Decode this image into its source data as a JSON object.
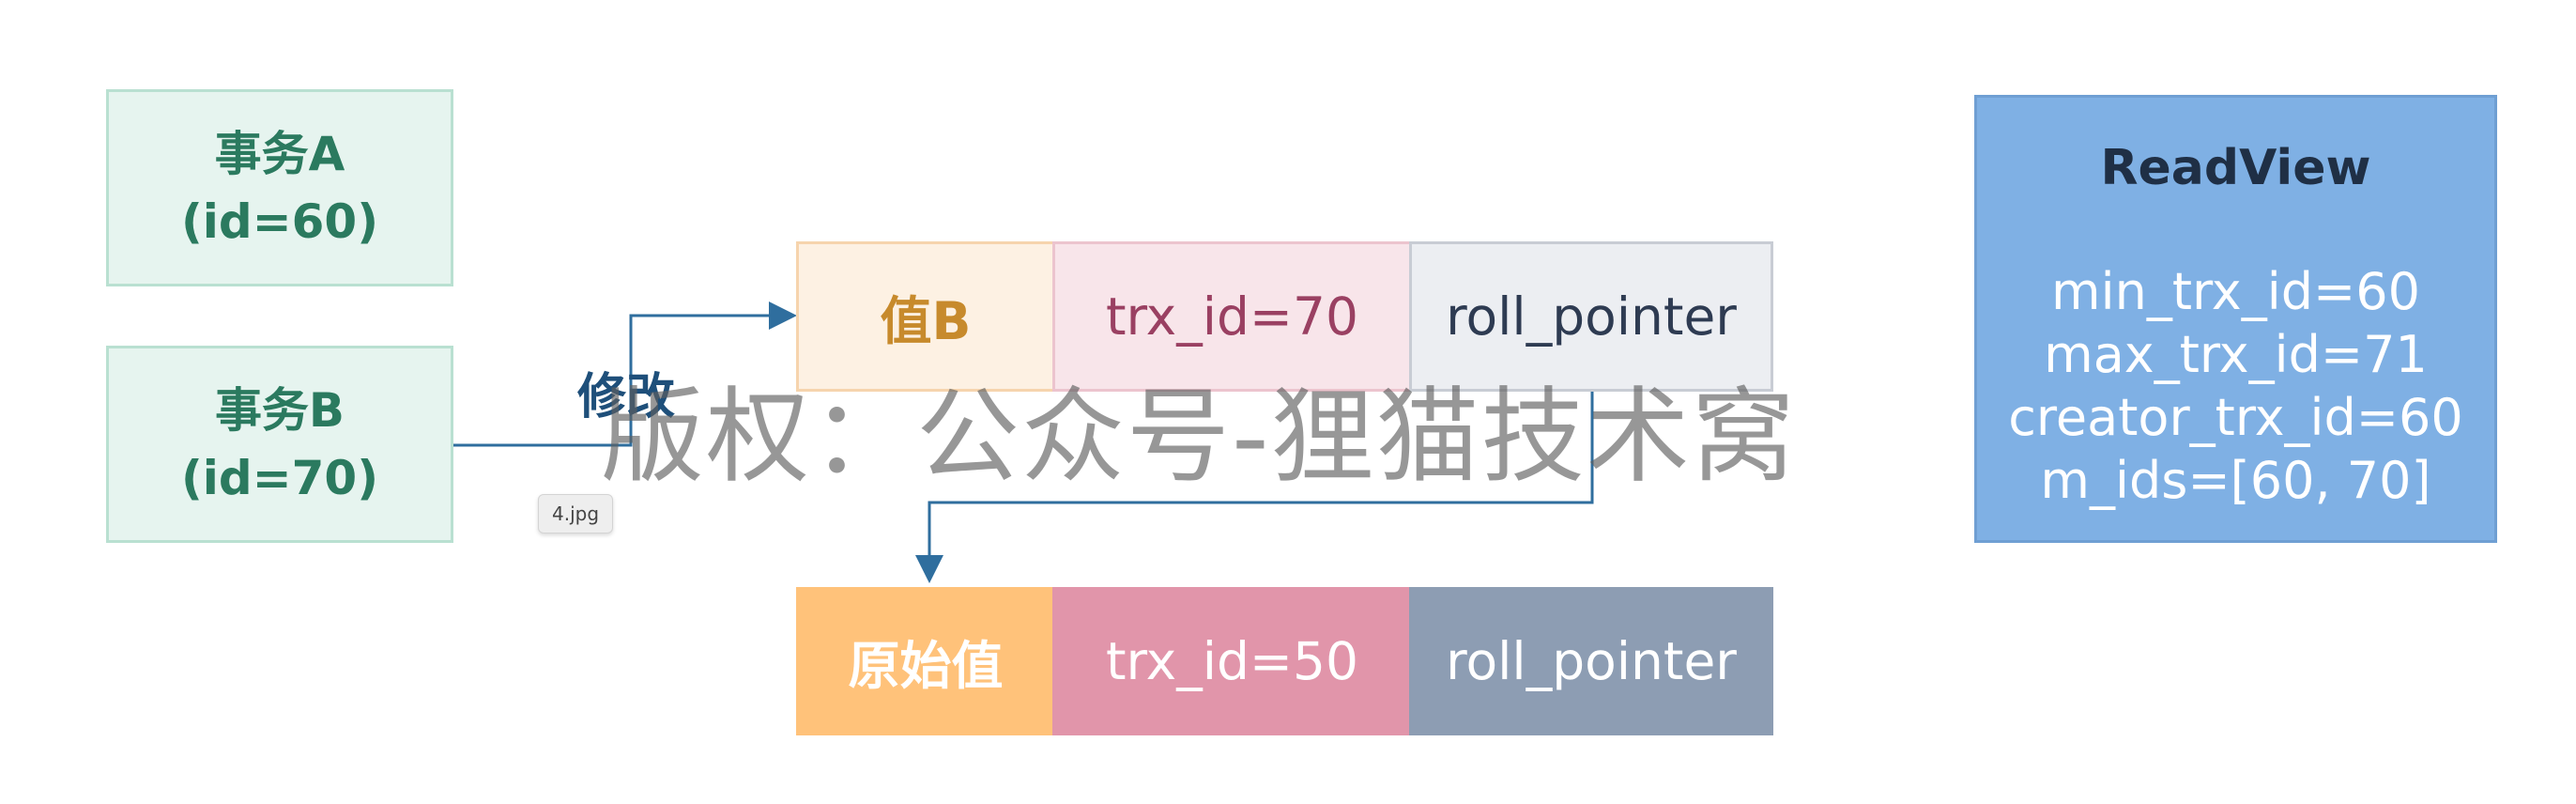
{
  "transactions": {
    "a": {
      "name": "事务A",
      "id": "(id=60)"
    },
    "b": {
      "name": "事务B",
      "id": "(id=70)"
    }
  },
  "arrow_label": "修改",
  "tooltip": "4.jpg",
  "row_modified": {
    "value": "值B",
    "trx_id": "trx_id=70",
    "roll_pointer": "roll_pointer"
  },
  "row_original": {
    "value": "原始值",
    "trx_id": "trx_id=50",
    "roll_pointer": "roll_pointer"
  },
  "readview": {
    "title": "ReadView",
    "lines": [
      "min_trx_id=60",
      "max_trx_id=71",
      "creator_trx_id=60",
      "m_ids=[60, 70]"
    ]
  },
  "watermark": "版权：公众号-狸猫技术窝",
  "colors": {
    "tx_fill": "#e6f4ef",
    "tx_text": "#2b7a5f",
    "arrow": "#2f6e9e",
    "readview_fill": "#7fb0e4",
    "orange": "#ffc27a",
    "pink": "#e195aa",
    "slate": "#8d9db3"
  }
}
